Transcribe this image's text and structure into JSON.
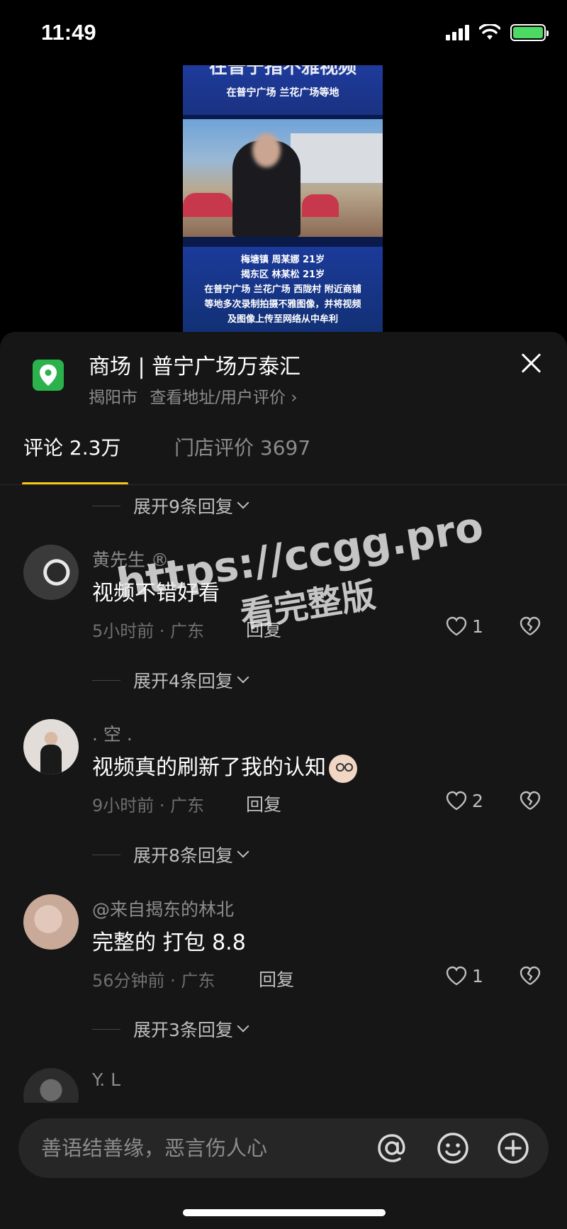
{
  "status_bar": {
    "time": "11:49"
  },
  "video": {
    "banner_top": "在普宁指不雅视频",
    "banner_sub": "在普宁广场 兰花广场等地",
    "caption_lines": [
      "梅塘镇 周某娜 21岁",
      "揭东区 林某松 21岁",
      "在普宁广场 兰花广场 西陇村 附近商铺",
      "等地多次录制拍摄不雅图像，并将视频",
      "及图像上传至网络从中牟利"
    ]
  },
  "location": {
    "title": "商场 | 普宁广场万泰汇",
    "city": "揭阳市",
    "link": "查看地址/用户评价 ›"
  },
  "tabs": [
    {
      "label": "评论 2.3万"
    },
    {
      "label": "门店评价 3697"
    }
  ],
  "expand_labels": [
    "展开9条回复",
    "展开4条回复",
    "展开8条回复",
    "展开3条回复"
  ],
  "comments": [
    {
      "user": "黄先生.®",
      "text": "视频不错好看",
      "time_loc": "5小时前 · 广东",
      "reply": "回复",
      "likes": "1"
    },
    {
      "user": ". 空 .",
      "text": "视频真的刷新了我的认知",
      "time_loc": "9小时前 · 广东",
      "reply": "回复",
      "likes": "2"
    },
    {
      "user": "@来自揭东的林北",
      "text": "完整的 打包 8.8",
      "time_loc": "56分钟前 · 广东",
      "reply": "回复",
      "likes": "1"
    },
    {
      "user": "Y. L"
    }
  ],
  "watermark": {
    "url": "https://ccgg.pro",
    "sub": "看完整版"
  },
  "input": {
    "placeholder": "善语结善缘，恶言伤人心"
  },
  "icons": [
    "signal-icon",
    "wifi-icon",
    "battery-icon",
    "location-pin-icon",
    "close-icon",
    "heart-icon",
    "broken-heart-icon",
    "at-icon",
    "emoji-icon",
    "plus-icon"
  ],
  "colors": {
    "accent": "#f5c518",
    "sheet_bg": "#161616",
    "location_icon": "#2bb24c",
    "battery": "#4cd964"
  }
}
